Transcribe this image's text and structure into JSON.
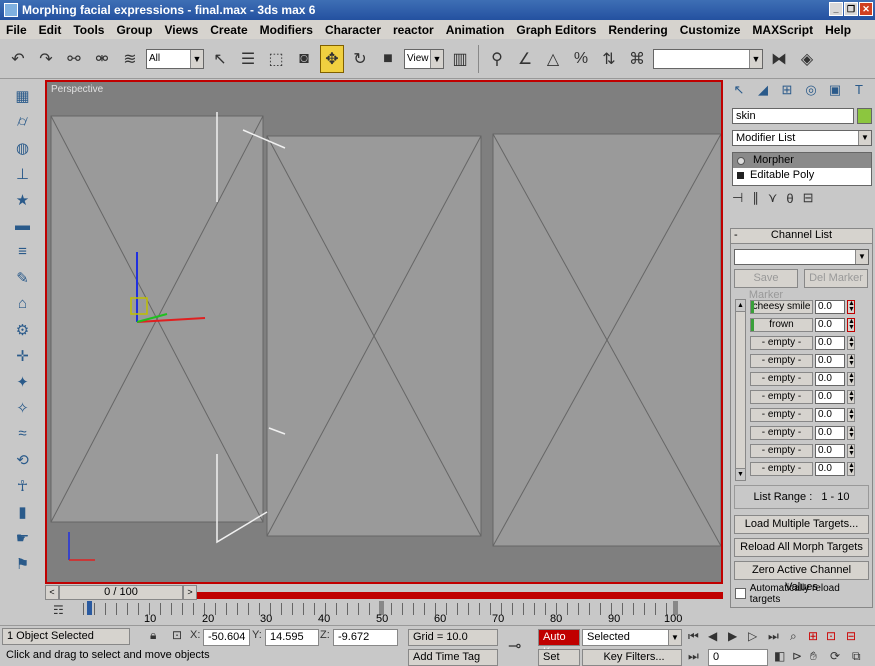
{
  "window": {
    "title": "Morphing facial expressions - final.max - 3ds max 6"
  },
  "menu": [
    "File",
    "Edit",
    "Tools",
    "Group",
    "Views",
    "Create",
    "Modifiers",
    "Character",
    "reactor",
    "Animation",
    "Graph Editors",
    "Rendering",
    "Customize",
    "MAXScript",
    "Help"
  ],
  "toolbar": {
    "selection_filter": "All",
    "ref_coord": "View",
    "named_selection": ""
  },
  "viewport": {
    "label": "Perspective"
  },
  "timeslider": {
    "frame": "0 / 100"
  },
  "trackbar": {
    "ticks": [
      "10",
      "20",
      "30",
      "40",
      "50",
      "60",
      "70",
      "80",
      "90",
      "100"
    ]
  },
  "command_panel": {
    "object_name": "skin",
    "object_color": "#8cc63f",
    "modifier_list": "Modifier List",
    "stack": [
      "Morpher",
      "Editable Poly"
    ],
    "channel_list": {
      "title": "Channel List",
      "save_marker": "Save Marker",
      "del_marker": "Del Marker",
      "channels": [
        {
          "name": "cheesy smile",
          "value": "0.0"
        },
        {
          "name": "frown",
          "value": "0.0"
        },
        {
          "name": "- empty -",
          "value": "0.0"
        },
        {
          "name": "- empty -",
          "value": "0.0"
        },
        {
          "name": "- empty -",
          "value": "0.0"
        },
        {
          "name": "- empty -",
          "value": "0.0"
        },
        {
          "name": "- empty -",
          "value": "0.0"
        },
        {
          "name": "- empty -",
          "value": "0.0"
        },
        {
          "name": "- empty -",
          "value": "0.0"
        },
        {
          "name": "- empty -",
          "value": "0.0"
        }
      ],
      "list_range_label": "List Range :",
      "list_range_value": "1 - 10",
      "load_multiple": "Load Multiple Targets...",
      "reload_all": "Reload All Morph Targets",
      "zero_active": "Zero Active Channel Values",
      "auto_reload": "Automatically reload targets"
    }
  },
  "status": {
    "selection": "1 Object Selected",
    "prompt": "Click and drag to select and move objects",
    "x_label": "X:",
    "x": "-50.604",
    "y_label": "Y:",
    "y": "14.595",
    "z_label": "Z:",
    "z": "-9.672",
    "grid": "Grid = 10.0",
    "add_time_tag": "Add Time Tag",
    "auto_key": "Auto Key",
    "selected": "Selected",
    "set_key": "Set Key",
    "key_filters": "Key Filters...",
    "frame": "0"
  }
}
